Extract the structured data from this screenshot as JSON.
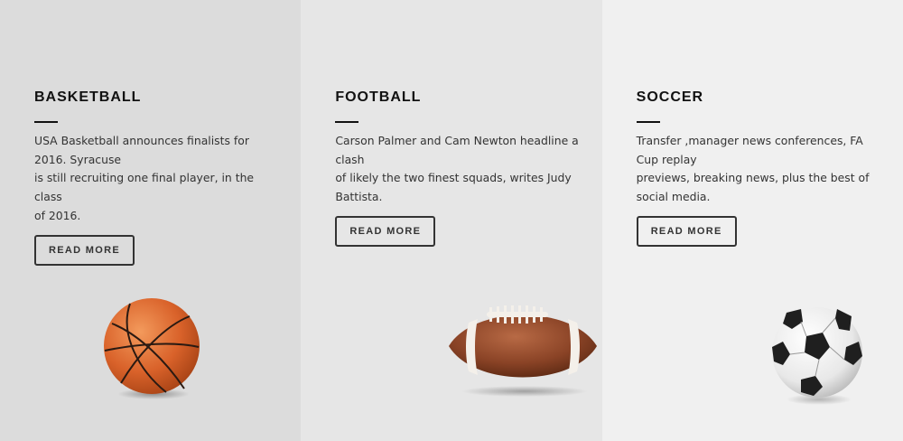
{
  "cards": [
    {
      "title": "BASKETBALL",
      "lines": [
        "USA Basketball announces finalists for",
        "2016. Syracuse",
        "is still recruiting one final player, in the class",
        "of 2016."
      ],
      "button": "READ MORE",
      "image_icon": "basketball-icon",
      "bg": "#dcdcdc"
    },
    {
      "title": "FOOTBALL",
      "lines": [
        "Carson Palmer and Cam Newton headline a",
        "clash",
        "of likely the two finest squads, writes Judy",
        "Battista."
      ],
      "button": "READ MORE",
      "image_icon": "american-football-icon",
      "bg": "#e6e6e6"
    },
    {
      "title": "SOCCER",
      "lines": [
        "Transfer ,manager news conferences, FA",
        "Cup replay",
        "previews, breaking news, plus the best of",
        "social media."
      ],
      "button": "READ MORE",
      "image_icon": "soccer-ball-icon",
      "bg": "#f0f0f0"
    }
  ]
}
